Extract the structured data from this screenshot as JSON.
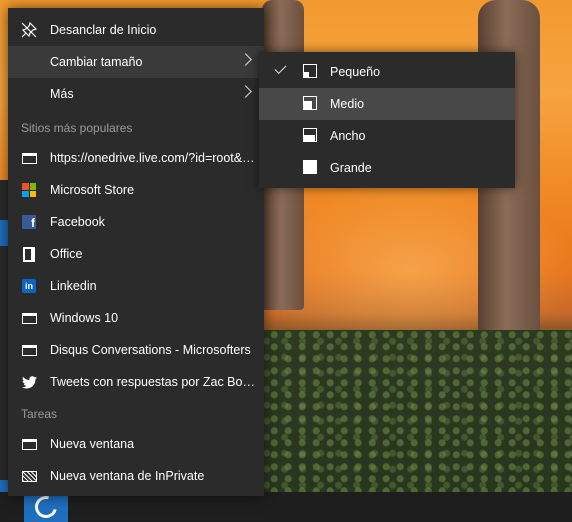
{
  "context_menu": {
    "items": [
      {
        "label": "Desanclar de Inicio",
        "icon": "unpin-icon"
      },
      {
        "label": "Cambiar tamaño",
        "icon": "",
        "has_submenu": true
      },
      {
        "label": "Más",
        "icon": "",
        "has_submenu": true
      }
    ],
    "section_popular": "Sitios más populares",
    "popular": [
      {
        "label": "https://onedrive.live.com/?id=root&ci...",
        "icon": "page-icon"
      },
      {
        "label": "Microsoft Store",
        "icon": "store-icon"
      },
      {
        "label": "Facebook",
        "icon": "facebook-icon"
      },
      {
        "label": "Office",
        "icon": "office-icon"
      },
      {
        "label": "Linkedin",
        "icon": "linkedin-icon"
      },
      {
        "label": "Windows 10",
        "icon": "page-icon"
      },
      {
        "label": "Disqus Conversations - Microsofters",
        "icon": "page-icon"
      },
      {
        "label": "Tweets con respuestas por Zac Bowde...",
        "icon": "twitter-icon"
      }
    ],
    "section_tasks": "Tareas",
    "tasks": [
      {
        "label": "Nueva ventana",
        "icon": "window-icon"
      },
      {
        "label": "Nueva ventana de InPrivate",
        "icon": "inprivate-icon"
      }
    ]
  },
  "resize_submenu": {
    "options": [
      {
        "label": "Pequeño",
        "checked": true
      },
      {
        "label": "Medio",
        "checked": false,
        "highlighted": true
      },
      {
        "label": "Ancho",
        "checked": false
      },
      {
        "label": "Grande",
        "checked": false
      }
    ]
  },
  "colors": {
    "menu_bg": "#2b2b2b",
    "highlight": "#3a3a3a",
    "accent_blue": "#1f6fc0"
  }
}
